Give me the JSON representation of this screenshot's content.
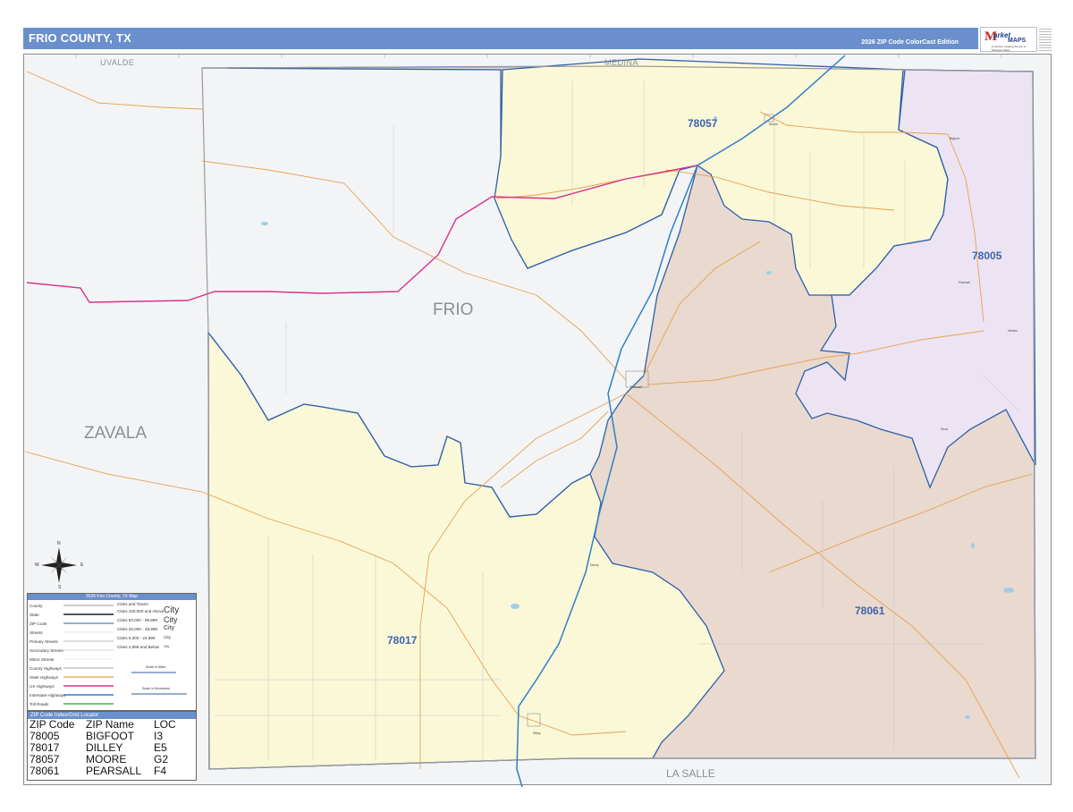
{
  "header": {
    "title": "FRIO COUNTY, TX",
    "edition": "2026 ZIP Code ColorCast Edition"
  },
  "logo": {
    "mark": "M",
    "word1": "arket",
    "word2": "MAPS",
    "tagline": "America's Leading Source of Business Maps"
  },
  "colors": {
    "zip_78005": "#ece4f3",
    "zip_78017": "#fbf8d8",
    "zip_78057": "#fbf8d8",
    "zip_78061": "#e9d9cf",
    "outside": "#f3f4f6",
    "header": "#6a8fcc",
    "zip_boundary": "#2d5fa8",
    "interstate": "#2f7fc8",
    "us_highway": "#d6338f",
    "state_highway": "#e8a14f",
    "county_line": "#9a9a9a"
  },
  "map": {
    "county_label": "FRIO",
    "neighbors": {
      "north_west": "UVALDE",
      "north": "MEDINA",
      "west": "ZAVALA",
      "south": "LA SALLE"
    },
    "zip_labels": [
      {
        "zip": "78057"
      },
      {
        "zip": "78005"
      },
      {
        "zip": "78061"
      },
      {
        "zip": "78017"
      }
    ],
    "towns": [
      "Dilley",
      "Derby",
      "Pearsall",
      "Moore",
      "Bigfoot",
      "Pearsall",
      "Hindes",
      "Divot"
    ]
  },
  "legend": {
    "title": "2026 Frio County, TX Map",
    "lines": [
      "County",
      "State",
      "ZIP Code",
      "Streets",
      "Primary Streets",
      "Secondary Streets",
      "Minor Streets",
      "County Highways",
      "State Highways",
      "US Highways",
      "Interstate Highways",
      "Toll Roads"
    ],
    "cities_title": "Cities and Towns",
    "city_classes": [
      {
        "range": "Cities 100,000 and Above",
        "sample": "City"
      },
      {
        "range": "Cities 50,000 - 99,999",
        "sample": "City"
      },
      {
        "range": "Cities 25,000 - 49,999",
        "sample": "City"
      },
      {
        "range": "Cities 5,000 - 24,999",
        "sample": "City"
      },
      {
        "range": "Cities 4,999 and Below",
        "sample": "City"
      }
    ],
    "scale_miles": "Scale in Miles",
    "scale_km": "Scale in Kilometers"
  },
  "compass": {
    "n": "N",
    "s": "S",
    "e": "E",
    "w": "W"
  },
  "zip_table": {
    "title": "ZIP Code Index/Grid Locator",
    "columns": [
      "ZIP Code",
      "ZIP Name",
      "LOC"
    ],
    "rows": [
      [
        "78005",
        "BIGFOOT",
        "I3"
      ],
      [
        "78017",
        "DILLEY",
        "E5"
      ],
      [
        "78057",
        "MOORE",
        "G2"
      ],
      [
        "78061",
        "PEARSALL",
        "F4"
      ]
    ]
  }
}
